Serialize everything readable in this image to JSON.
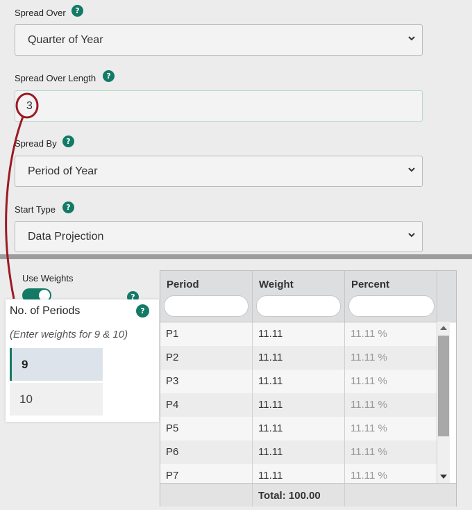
{
  "fields": {
    "spread_over": {
      "label": "Spread Over",
      "value": "Quarter of Year",
      "help": "?"
    },
    "spread_over_length": {
      "label": "Spread Over Length",
      "value": "3",
      "help": "?"
    },
    "spread_by": {
      "label": "Spread By",
      "value": "Period of Year",
      "help": "?"
    },
    "start_type": {
      "label": "Start Type",
      "value": "Data Projection",
      "help": "?"
    }
  },
  "weights": {
    "use_weights_label": "Use Weights",
    "toggle_on": true,
    "help": "?"
  },
  "periods_panel": {
    "title": "No. of Periods",
    "help": "?",
    "hint": "(Enter weights for 9 & 10)",
    "options": [
      "9",
      "10"
    ],
    "selected": "9"
  },
  "grid": {
    "headers": [
      "Period",
      "Weight",
      "Percent"
    ],
    "rows": [
      {
        "period": "P1",
        "weight": "11.11",
        "percent": "11.11 %"
      },
      {
        "period": "P2",
        "weight": "11.11",
        "percent": "11.11 %"
      },
      {
        "period": "P3",
        "weight": "11.11",
        "percent": "11.11 %"
      },
      {
        "period": "P4",
        "weight": "11.11",
        "percent": "11.11 %"
      },
      {
        "period": "P5",
        "weight": "11.11",
        "percent": "11.11 %"
      },
      {
        "period": "P6",
        "weight": "11.11",
        "percent": "11.11 %"
      },
      {
        "period": "P7",
        "weight": "11.11",
        "percent": "11.11 %"
      }
    ],
    "total": "Total: 100.00"
  },
  "colors": {
    "accent": "#137a66",
    "annotation": "#9b1b23"
  }
}
